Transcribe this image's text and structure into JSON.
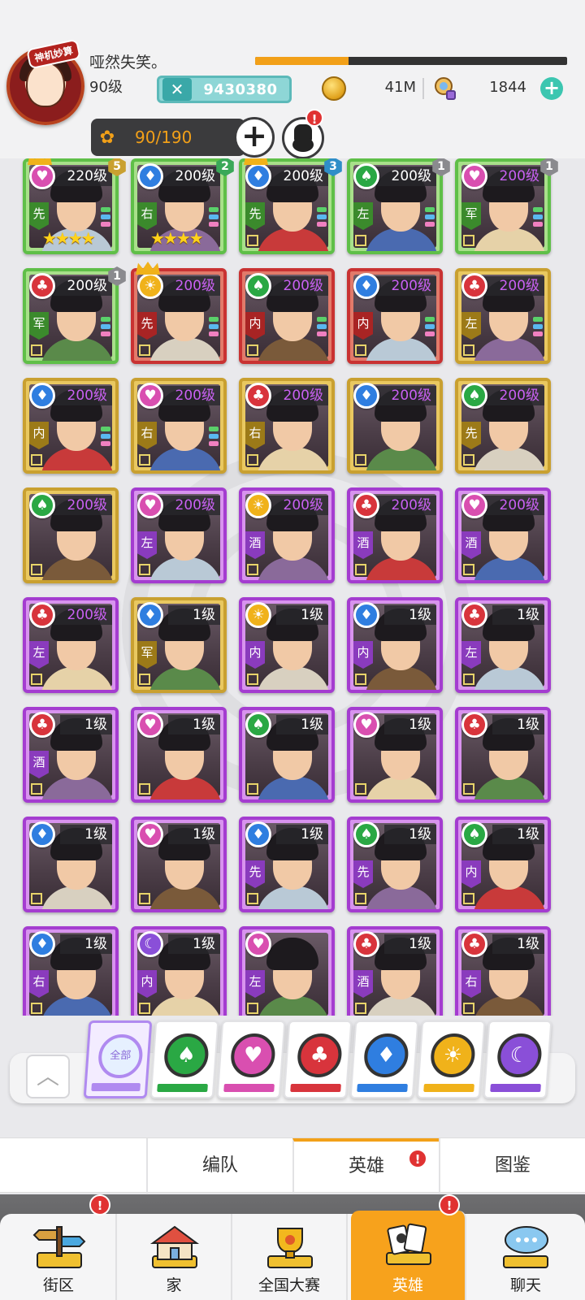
{
  "player": {
    "name": "哑然失笑。",
    "level": "90级",
    "power": "9430380",
    "gold": "41M",
    "gems": "1844",
    "xp_progress": 0.3,
    "avatar_tag": "神机妙算"
  },
  "roster": {
    "capacity": "90/190",
    "add_label": "+"
  },
  "colors": {
    "accent": "#f2a018",
    "teal": "#5cb9b9",
    "alert": "#e03232"
  },
  "heroes": [
    {
      "level": "220级",
      "suit": "heart",
      "pos": "先",
      "frame": "green",
      "stars": "★★★★",
      "badge": "5",
      "badge_color": "#c9a030",
      "crown": true
    },
    {
      "level": "200级",
      "suit": "diamond",
      "pos": "右",
      "frame": "green",
      "stars": "★★★★",
      "badge": "2",
      "badge_color": "#3aa858",
      "crown": false
    },
    {
      "level": "200级",
      "suit": "diamond",
      "pos": "先",
      "frame": "green",
      "stars": "",
      "badge": "3",
      "badge_color": "#2f8ec8",
      "crown": true
    },
    {
      "level": "200级",
      "suit": "spade",
      "pos": "左",
      "frame": "green",
      "stars": "",
      "badge": "1",
      "badge_color": "#8a8a8e",
      "crown": false
    },
    {
      "level": "200级",
      "suit": "heart",
      "pos": "军",
      "frame": "green",
      "stars": "",
      "badge": "1",
      "badge_color": "#8a8a8e",
      "crown": false,
      "purple": true
    },
    {
      "level": "200级",
      "suit": "club",
      "pos": "军",
      "frame": "green",
      "stars": "",
      "badge": "1",
      "badge_color": "#8a8a8e",
      "crown": false
    },
    {
      "level": "200级",
      "suit": "sun",
      "pos": "先",
      "frame": "red",
      "purple": true,
      "crown": true
    },
    {
      "level": "200级",
      "suit": "spade",
      "pos": "内",
      "frame": "red",
      "purple": true
    },
    {
      "level": "200级",
      "suit": "diamond",
      "pos": "内",
      "frame": "red",
      "purple": true
    },
    {
      "level": "200级",
      "suit": "club",
      "pos": "左",
      "frame": "gold",
      "purple": true
    },
    {
      "level": "200级",
      "suit": "diamond",
      "pos": "内",
      "frame": "gold",
      "purple": true
    },
    {
      "level": "200级",
      "suit": "heart",
      "pos": "右",
      "frame": "gold",
      "purple": true
    },
    {
      "level": "200级",
      "suit": "club",
      "pos": "右",
      "frame": "gold",
      "purple": true
    },
    {
      "level": "200级",
      "suit": "diamond",
      "pos": "",
      "frame": "gold",
      "purple": true
    },
    {
      "level": "200级",
      "suit": "spade",
      "pos": "先",
      "frame": "gold",
      "purple": true
    },
    {
      "level": "200级",
      "suit": "spade",
      "pos": "",
      "frame": "gold",
      "purple": true
    },
    {
      "level": "200级",
      "suit": "heart",
      "pos": "左",
      "frame": "purple",
      "purple": true
    },
    {
      "level": "200级",
      "suit": "sun",
      "pos": "酒",
      "frame": "purple",
      "purple": true
    },
    {
      "level": "200级",
      "suit": "club",
      "pos": "酒",
      "frame": "purple",
      "purple": true
    },
    {
      "level": "200级",
      "suit": "heart",
      "pos": "酒",
      "frame": "purple",
      "purple": true
    },
    {
      "level": "200级",
      "suit": "club",
      "pos": "左",
      "frame": "purple",
      "purple": true
    },
    {
      "level": "1级",
      "suit": "diamond",
      "pos": "军",
      "frame": "gold"
    },
    {
      "level": "1级",
      "suit": "sun",
      "pos": "内",
      "frame": "purple"
    },
    {
      "level": "1级",
      "suit": "diamond",
      "pos": "内",
      "frame": "purple"
    },
    {
      "level": "1级",
      "suit": "club",
      "pos": "左",
      "frame": "purple"
    },
    {
      "level": "1级",
      "suit": "club",
      "pos": "酒",
      "frame": "purple"
    },
    {
      "level": "1级",
      "suit": "heart",
      "pos": "",
      "frame": "purple"
    },
    {
      "level": "1级",
      "suit": "spade",
      "pos": "",
      "frame": "purple"
    },
    {
      "level": "1级",
      "suit": "heart",
      "pos": "",
      "frame": "purple"
    },
    {
      "level": "1级",
      "suit": "club",
      "pos": "",
      "frame": "purple"
    },
    {
      "level": "1级",
      "suit": "diamond",
      "pos": "",
      "frame": "purple"
    },
    {
      "level": "1级",
      "suit": "heart",
      "pos": "",
      "frame": "purple"
    },
    {
      "level": "1级",
      "suit": "diamond",
      "pos": "先",
      "frame": "purple"
    },
    {
      "level": "1级",
      "suit": "spade",
      "pos": "先",
      "frame": "purple"
    },
    {
      "level": "1级",
      "suit": "spade",
      "pos": "内",
      "frame": "purple"
    },
    {
      "level": "1级",
      "suit": "diamond",
      "pos": "右",
      "frame": "purple"
    },
    {
      "level": "1级",
      "suit": "moon",
      "pos": "内",
      "frame": "purple"
    },
    {
      "level": "",
      "suit": "heart",
      "pos": "左",
      "frame": "purple"
    },
    {
      "level": "1级",
      "suit": "club",
      "pos": "酒",
      "frame": "purple"
    },
    {
      "level": "1级",
      "suit": "club",
      "pos": "右",
      "frame": "purple"
    }
  ],
  "filters": [
    {
      "name": "all",
      "label": "全部",
      "color": "#b08af0"
    },
    {
      "name": "spade",
      "label": "",
      "color": "#2aa844"
    },
    {
      "name": "heart",
      "label": "",
      "color": "#d94fb0"
    },
    {
      "name": "club",
      "label": "",
      "color": "#d8343c"
    },
    {
      "name": "diamond",
      "label": "",
      "color": "#2f7ee0"
    },
    {
      "name": "sun",
      "label": "",
      "color": "#f0b21a"
    },
    {
      "name": "moon",
      "label": "",
      "color": "#8a4fd8"
    }
  ],
  "subtabs": {
    "formation": "编队",
    "heroes": "英雄",
    "codex": "图鉴"
  },
  "nav": {
    "street": "街区",
    "home": "家",
    "contest": "全国大赛",
    "heroes": "英雄",
    "chat": "聊天"
  },
  "alert_mark": "!"
}
